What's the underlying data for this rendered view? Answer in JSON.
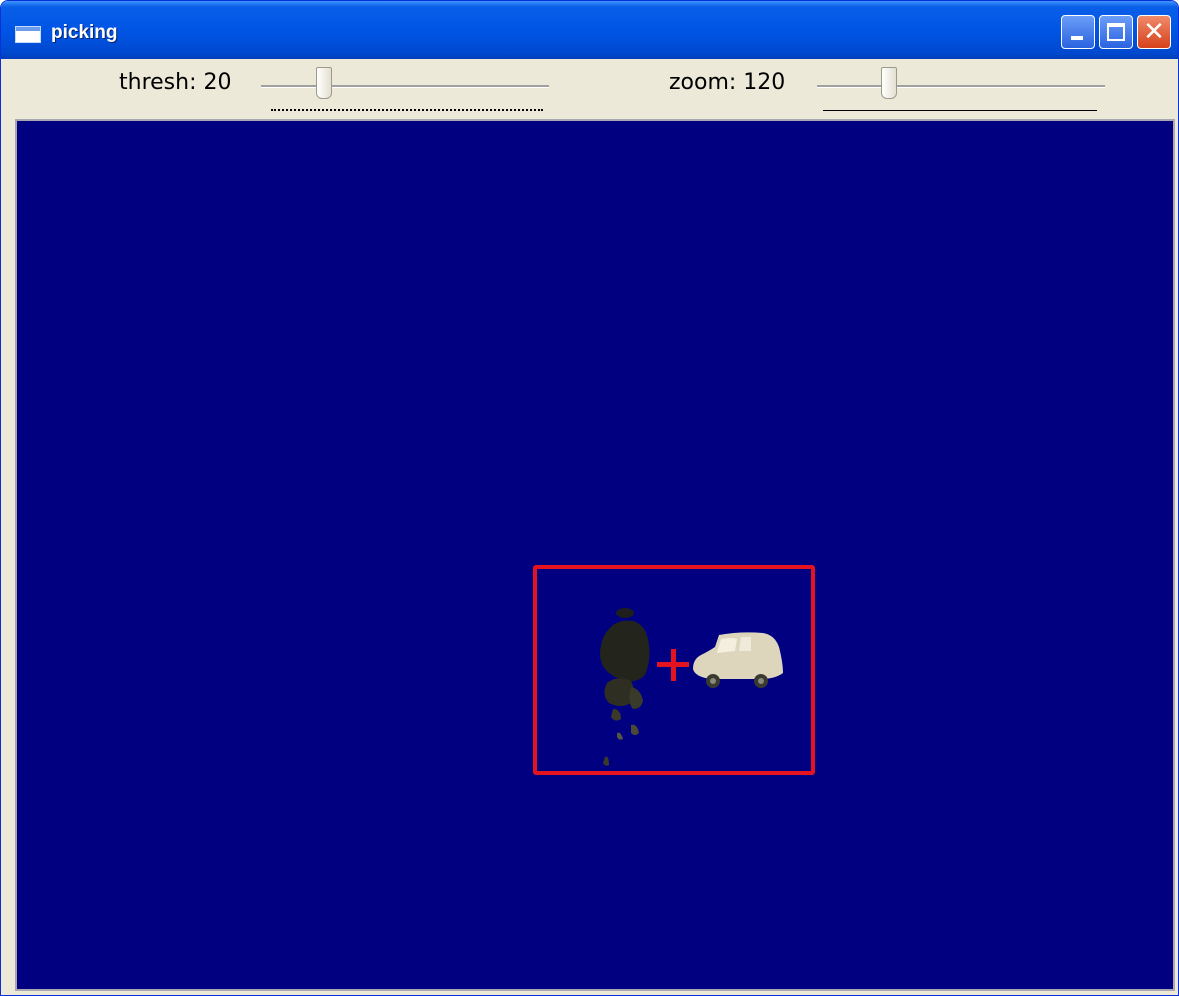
{
  "window": {
    "title": "picking",
    "icons": {
      "app": "window-icon",
      "minimize": "minimize-icon",
      "maximize": "maximize-icon",
      "close": "close-icon"
    }
  },
  "toolbar": {
    "thresh": {
      "label": "thresh: 20",
      "value": 20,
      "fraction": 0.22
    },
    "zoom": {
      "label": "zoom: 120",
      "value": 120,
      "fraction": 0.25
    }
  },
  "colors": {
    "viewport_background": "#000080",
    "pick_rect": "#e3141f",
    "titlebar": "#0055e5",
    "frame": "#ece9d8"
  },
  "viewport": {
    "content": [
      "person-silhouette",
      "car-silhouette"
    ],
    "markers": [
      "pick-rectangle",
      "crosshair-icon"
    ]
  }
}
